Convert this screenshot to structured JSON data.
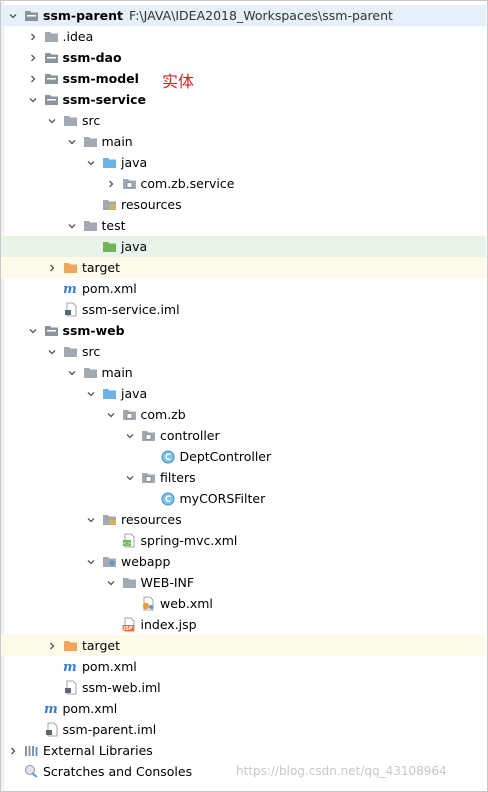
{
  "annotation": "实体",
  "watermark": "https://blog.csdn.net/qq_43108964",
  "tree": [
    {
      "depth": 0,
      "arrow": "down",
      "icon": "module-folder-icon",
      "label": "ssm-parent",
      "bold": true,
      "path": "F:\\JAVA\\IDEA2018_Workspaces\\ssm-parent",
      "hl": "rootsel"
    },
    {
      "depth": 1,
      "arrow": "right",
      "icon": "folder-icon",
      "label": ".idea"
    },
    {
      "depth": 1,
      "arrow": "right",
      "icon": "module-folder-icon",
      "label": "ssm-dao",
      "bold": true
    },
    {
      "depth": 1,
      "arrow": "right",
      "icon": "module-folder-icon",
      "label": "ssm-model",
      "bold": true
    },
    {
      "depth": 1,
      "arrow": "down",
      "icon": "module-folder-icon",
      "label": "ssm-service",
      "bold": true
    },
    {
      "depth": 2,
      "arrow": "down",
      "icon": "folder-icon",
      "label": "src"
    },
    {
      "depth": 3,
      "arrow": "down",
      "icon": "folder-icon",
      "label": "main"
    },
    {
      "depth": 4,
      "arrow": "down",
      "icon": "source-folder-icon",
      "label": "java"
    },
    {
      "depth": 5,
      "arrow": "right",
      "icon": "package-icon",
      "label": "com.zb.service"
    },
    {
      "depth": 4,
      "arrow": "",
      "icon": "resources-folder-icon",
      "label": "resources"
    },
    {
      "depth": 3,
      "arrow": "down",
      "icon": "folder-icon",
      "label": "test"
    },
    {
      "depth": 4,
      "arrow": "",
      "icon": "test-folder-icon",
      "label": "java",
      "hl": "sel"
    },
    {
      "depth": 2,
      "arrow": "right",
      "icon": "excluded-folder-icon",
      "label": "target",
      "hl": "ex"
    },
    {
      "depth": 2,
      "arrow": "",
      "icon": "maven-icon",
      "label": "pom.xml"
    },
    {
      "depth": 2,
      "arrow": "",
      "icon": "iml-file-icon",
      "label": "ssm-service.iml"
    },
    {
      "depth": 1,
      "arrow": "down",
      "icon": "module-folder-icon",
      "label": "ssm-web",
      "bold": true
    },
    {
      "depth": 2,
      "arrow": "down",
      "icon": "folder-icon",
      "label": "src"
    },
    {
      "depth": 3,
      "arrow": "down",
      "icon": "folder-icon",
      "label": "main"
    },
    {
      "depth": 4,
      "arrow": "down",
      "icon": "source-folder-icon",
      "label": "java"
    },
    {
      "depth": 5,
      "arrow": "down",
      "icon": "package-icon",
      "label": "com.zb"
    },
    {
      "depth": 6,
      "arrow": "down",
      "icon": "package-icon",
      "label": "controller"
    },
    {
      "depth": 7,
      "arrow": "",
      "icon": "class-icon",
      "label": "DeptController"
    },
    {
      "depth": 6,
      "arrow": "down",
      "icon": "package-icon",
      "label": "filters"
    },
    {
      "depth": 7,
      "arrow": "",
      "icon": "class-icon",
      "label": "myCORSFilter"
    },
    {
      "depth": 4,
      "arrow": "down",
      "icon": "resources-folder-icon",
      "label": "resources"
    },
    {
      "depth": 5,
      "arrow": "",
      "icon": "spring-xml-icon",
      "label": "spring-mvc.xml"
    },
    {
      "depth": 4,
      "arrow": "down",
      "icon": "webapp-folder-icon",
      "label": "webapp"
    },
    {
      "depth": 5,
      "arrow": "down",
      "icon": "folder-icon",
      "label": "WEB-INF"
    },
    {
      "depth": 6,
      "arrow": "",
      "icon": "web-xml-icon",
      "label": "web.xml"
    },
    {
      "depth": 5,
      "arrow": "",
      "icon": "jsp-icon",
      "label": "index.jsp"
    },
    {
      "depth": 2,
      "arrow": "right",
      "icon": "excluded-folder-icon",
      "label": "target",
      "hl": "ex"
    },
    {
      "depth": 2,
      "arrow": "",
      "icon": "maven-icon",
      "label": "pom.xml"
    },
    {
      "depth": 2,
      "arrow": "",
      "icon": "iml-file-icon",
      "label": "ssm-web.iml"
    },
    {
      "depth": 1,
      "arrow": "",
      "icon": "maven-icon",
      "label": "pom.xml"
    },
    {
      "depth": 1,
      "arrow": "",
      "icon": "iml-file-icon",
      "label": "ssm-parent.iml"
    },
    {
      "depth": 0,
      "arrow": "right",
      "icon": "libraries-icon",
      "label": "External Libraries"
    },
    {
      "depth": 0,
      "arrow": "",
      "icon": "scratches-icon",
      "label": "Scratches and Consoles"
    }
  ]
}
